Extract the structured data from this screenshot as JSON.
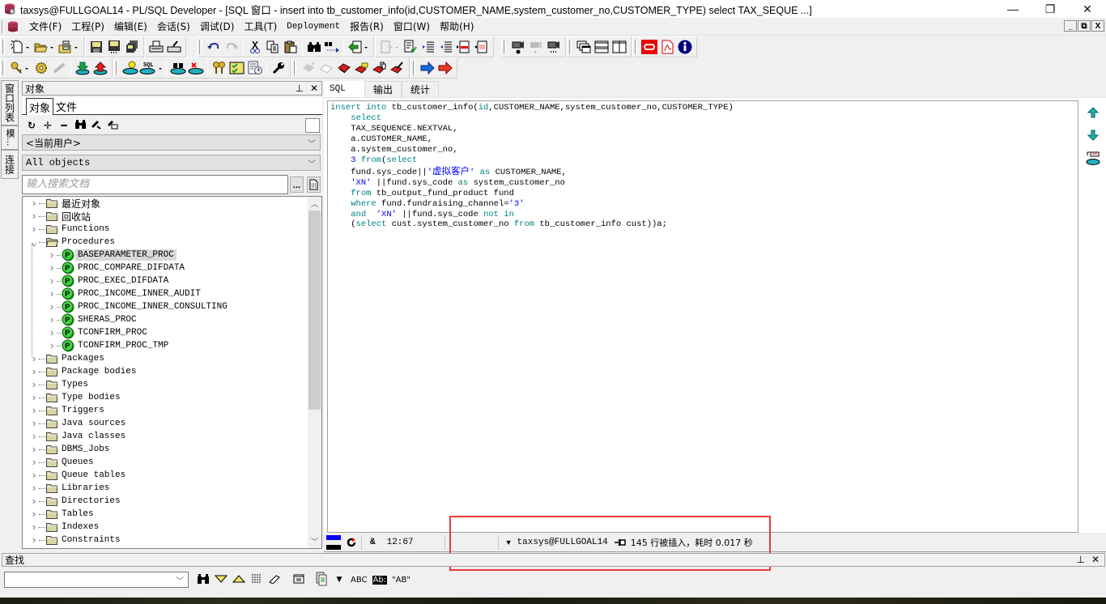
{
  "window": {
    "title": "taxsys@FULLGOAL14 - PL/SQL Developer - [SQL 窗口 - insert into tb_customer_info(id,CUSTOMER_NAME,system_customer_no,CUSTOMER_TYPE) select TAX_SEQUE ...]",
    "controls": {
      "minimize": "—",
      "restore": "❐",
      "close": "✕"
    },
    "mdi_controls": {
      "minimize": "_",
      "restore": "🗗",
      "close": "X"
    }
  },
  "menu": {
    "items": [
      {
        "label": "文件(F)"
      },
      {
        "label": "工程(P)"
      },
      {
        "label": "编辑(E)"
      },
      {
        "label": "会话(S)"
      },
      {
        "label": "调试(D)"
      },
      {
        "label": "工具(T)"
      },
      {
        "label": "Deployment"
      },
      {
        "label": "报告(R)"
      },
      {
        "label": "窗口(W)"
      },
      {
        "label": "帮助(H)"
      }
    ]
  },
  "toolbar1": {
    "icons": [
      "new-icon",
      "open-icon",
      "reopen-icon",
      "save-icon",
      "save-as-icon",
      "save-all-icon",
      "print-icon",
      "print-setup-icon",
      "undo-icon",
      "redo-icon",
      "cut-icon",
      "copy-icon",
      "paste-icon",
      "find-icon",
      "find-next-icon",
      "load-icon",
      "execute-icon",
      "explain-plan-icon",
      "indent-icon",
      "unindent-icon",
      "comment-icon",
      "uncomment-icon",
      "record-macro-icon",
      "play-macro-icon",
      "macro-library-icon",
      "new-window-icon",
      "tile-icon",
      "split-icon",
      "oracle-icon",
      "pdf-icon",
      "info-icon"
    ]
  },
  "toolbar2": {
    "icons": [
      "log-on-icon",
      "compile-icon",
      "compile-invalid-icon",
      "commit-icon",
      "rollback-icon",
      "execute-query-icon",
      "sql-icon",
      "find-db-objects-icon",
      "drop-icon",
      "grant-icon",
      "test-manager-icon",
      "report-icon",
      "preferences-icon",
      "vcs-icon",
      "vcs-checkout-icon",
      "vcs-add-icon",
      "vcs-folder-icon",
      "vcs-compare-icon",
      "vcs-edit-icon",
      "back-icon",
      "forward-icon"
    ]
  },
  "side_tabs": [
    {
      "label": "窗口列表"
    },
    {
      "label": "模..."
    },
    {
      "label": "连接"
    }
  ],
  "object_panel": {
    "title": "对象",
    "pin": "ф",
    "close": "✕",
    "tabs": [
      {
        "label": "对象",
        "active": true
      },
      {
        "label": "文件",
        "active": false
      }
    ],
    "tools": [
      "refresh-icon",
      "add-icon",
      "remove-icon",
      "find-icon",
      "filter-icon",
      "filter-edit-icon"
    ],
    "owner_select": "<当前用户>",
    "type_select": "All objects",
    "search_placeholder": "输入搜索文档",
    "search_value": "",
    "dots_label": "...",
    "tree": [
      {
        "label": "最近对象",
        "cjk": true,
        "expanded": false
      },
      {
        "label": "回收站",
        "cjk": true,
        "expanded": false
      },
      {
        "label": "Functions",
        "expanded": false
      },
      {
        "label": "Procedures",
        "expanded": true,
        "children": [
          {
            "label": "BASEPARAMETER_PROC",
            "selected": true
          },
          {
            "label": "PROC_COMPARE_DIFDATA"
          },
          {
            "label": "PROC_EXEC_DIFDATA"
          },
          {
            "label": "PROC_INCOME_INNER_AUDIT"
          },
          {
            "label": "PROC_INCOME_INNER_CONSULTING"
          },
          {
            "label": "SHERAS_PROC"
          },
          {
            "label": "TCONFIRM_PROC"
          },
          {
            "label": "TCONFIRM_PROC_TMP"
          }
        ]
      },
      {
        "label": "Packages"
      },
      {
        "label": "Package bodies"
      },
      {
        "label": "Types"
      },
      {
        "label": "Type bodies"
      },
      {
        "label": "Triggers"
      },
      {
        "label": "Java sources"
      },
      {
        "label": "Java classes"
      },
      {
        "label": "DBMS_Jobs"
      },
      {
        "label": "Queues"
      },
      {
        "label": "Queue tables"
      },
      {
        "label": "Libraries"
      },
      {
        "label": "Directories"
      },
      {
        "label": "Tables"
      },
      {
        "label": "Indexes"
      },
      {
        "label": "Constraints"
      }
    ]
  },
  "sql_window": {
    "tabs": [
      {
        "label": "SQL",
        "active": true
      },
      {
        "label": "输出"
      },
      {
        "label": "统计"
      }
    ],
    "code_lines": [
      [
        [
          "kw",
          "insert into"
        ],
        [
          "t",
          " tb_customer_info("
        ],
        [
          "kw",
          "id"
        ],
        [
          "t",
          ",CUSTOMER_NAME,system_customer_no,CUSTOMER_TYPE)"
        ]
      ],
      [
        [
          "t",
          "    "
        ],
        [
          "kw",
          "select"
        ]
      ],
      [
        [
          "t",
          "    TAX_SEQUENCE.NEXTVAL,"
        ]
      ],
      [
        [
          "t",
          "    a.CUSTOMER_NAME,"
        ]
      ],
      [
        [
          "t",
          "    a.system_customer_no,"
        ]
      ],
      [
        [
          "t",
          "    "
        ],
        [
          "num",
          "3"
        ],
        [
          "t",
          " "
        ],
        [
          "kw",
          "from"
        ],
        [
          "t",
          "("
        ],
        [
          "kw",
          "select"
        ]
      ],
      [
        [
          "t",
          "    fund.sys_code||"
        ],
        [
          "str",
          "'"
        ],
        [
          "cn",
          "虚拟客户"
        ],
        [
          "str",
          "'"
        ],
        [
          "t",
          " "
        ],
        [
          "kw",
          "as"
        ],
        [
          "t",
          " CUSTOMER_NAME,"
        ]
      ],
      [
        [
          "t",
          "    "
        ],
        [
          "str",
          "'XN'"
        ],
        [
          "t",
          " ||fund.sys_code "
        ],
        [
          "kw",
          "as"
        ],
        [
          "t",
          " system_customer_no"
        ]
      ],
      [
        [
          "t",
          "    "
        ],
        [
          "kw",
          "from"
        ],
        [
          "t",
          " tb_output_fund_product fund"
        ]
      ],
      [
        [
          "t",
          "    "
        ],
        [
          "kw",
          "where"
        ],
        [
          "t",
          " fund.fundraising_channel="
        ],
        [
          "str",
          "'3'"
        ]
      ],
      [
        [
          "t",
          "    "
        ],
        [
          "kw",
          "and"
        ],
        [
          "t",
          "  "
        ],
        [
          "str",
          "'XN'"
        ],
        [
          "t",
          " ||fund.sys_code "
        ],
        [
          "kw",
          "not in"
        ]
      ],
      [
        [
          "t",
          "    ("
        ],
        [
          "kw",
          "select"
        ],
        [
          "t",
          " cust.system_customer_no "
        ],
        [
          "kw",
          "from"
        ],
        [
          "t",
          " tb_customer_info cust))a;"
        ]
      ]
    ],
    "side_tools": [
      "previous-icon",
      "next-icon",
      "query-by-example-icon"
    ]
  },
  "status_bar": {
    "amp": "&",
    "cursor": "12:67",
    "connection": "taxsys@FULLGOAL14",
    "message": "145 行被插入，耗时 0.017 秒"
  },
  "find_bar": {
    "title": "查找",
    "pin": "ф",
    "close": "✕",
    "input_value": "",
    "tools": [
      "find-icon",
      "find-next-icon",
      "find-previous-icon",
      "highlight-icon",
      "clear-icon",
      "window-icon",
      "copy-results-icon",
      "dropdown-icon",
      "match-case-icon",
      "whole-word-icon",
      "quoted-icon"
    ],
    "labels": {
      "match_case": "ABC",
      "regex": "Ab:",
      "quoted": "\"AB\""
    }
  },
  "colors": {
    "keyword": "#008080",
    "literal": "#0000ff",
    "highlight_box": "#e83a3a",
    "selection": "#d9d9d9"
  }
}
